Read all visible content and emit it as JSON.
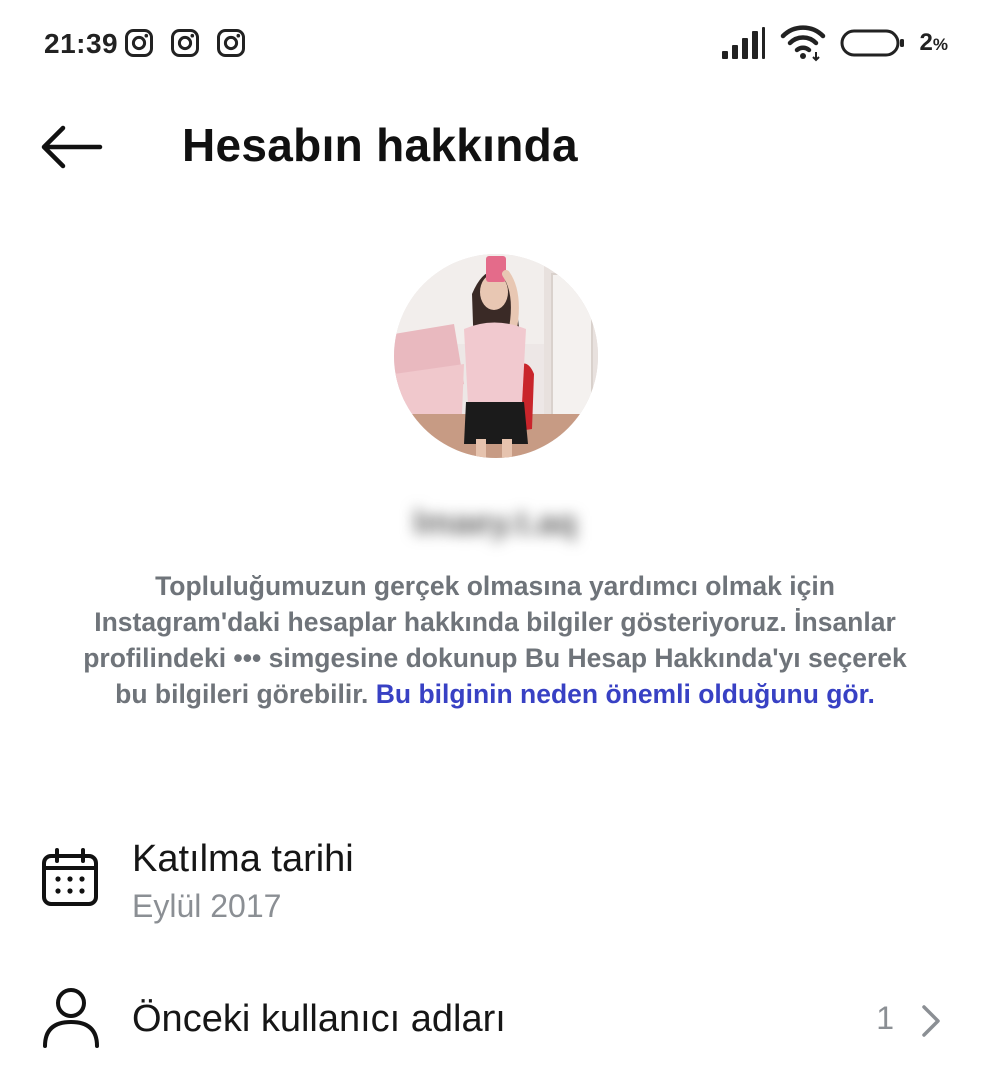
{
  "status_bar": {
    "time": "21:39",
    "notifications": [
      "instagram-icon",
      "instagram-icon",
      "instagram-icon"
    ],
    "battery_value": "2",
    "battery_unit": "%"
  },
  "header": {
    "title": "Hesabın hakkında"
  },
  "profile": {
    "username": "lmaey.t.aq"
  },
  "description": {
    "text": "Topluluğumuzun gerçek olmasına yardımcı olmak için Instagram'daki hesaplar hakkında bilgiler gösteriyoruz. İnsanlar profilindeki ••• simgesine dokunup Bu Hesap Hakkında'yı seçerek bu bilgileri görebilir.",
    "link": "Bu bilginin neden önemli olduğunu gör."
  },
  "rows": {
    "join_date": {
      "title": "Katılma tarihi",
      "value": "Eylül 2017",
      "icon": "calendar-icon"
    },
    "previous_usernames": {
      "title": "Önceki kullanıcı adları",
      "count": "1",
      "icon": "person-icon"
    }
  },
  "colors": {
    "link": "#3841c4",
    "description_text": "#6f747a",
    "secondary_text": "#8b8f94"
  }
}
